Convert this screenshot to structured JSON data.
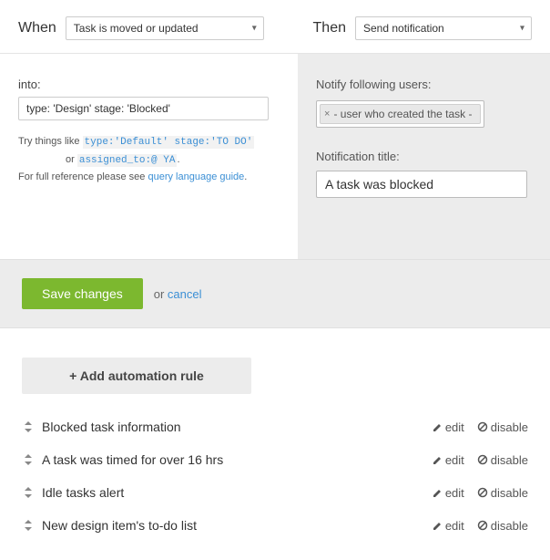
{
  "top": {
    "when_label": "When",
    "then_label": "Then",
    "when_value": "Task is moved or updated",
    "then_value": "Send notification"
  },
  "left": {
    "into_label": "into:",
    "into_value": "type: 'Design' stage: 'Blocked'",
    "hint_prefix": "Try things like",
    "hint_code1": "type:'Default' stage:'TO DO'",
    "hint_or": "or",
    "hint_code2": "assigned_to:@ YA",
    "hint_ref": "For full reference please see",
    "hint_link": "query language guide"
  },
  "right": {
    "notify_label": "Notify following users:",
    "tag_text": "- user who created the task -",
    "title_label": "Notification title:",
    "title_value": "A task was blocked"
  },
  "save": {
    "save_btn": "Save changes",
    "or": "or",
    "cancel": "cancel"
  },
  "rules": {
    "add_btn": "+ Add automation rule",
    "edit": "edit",
    "disable": "disable",
    "items": {
      "0": {
        "name": "Blocked task information"
      },
      "1": {
        "name": "A task was timed for over 16 hrs"
      },
      "2": {
        "name": "Idle tasks alert"
      },
      "3": {
        "name": "New design item's to-do list"
      }
    }
  }
}
